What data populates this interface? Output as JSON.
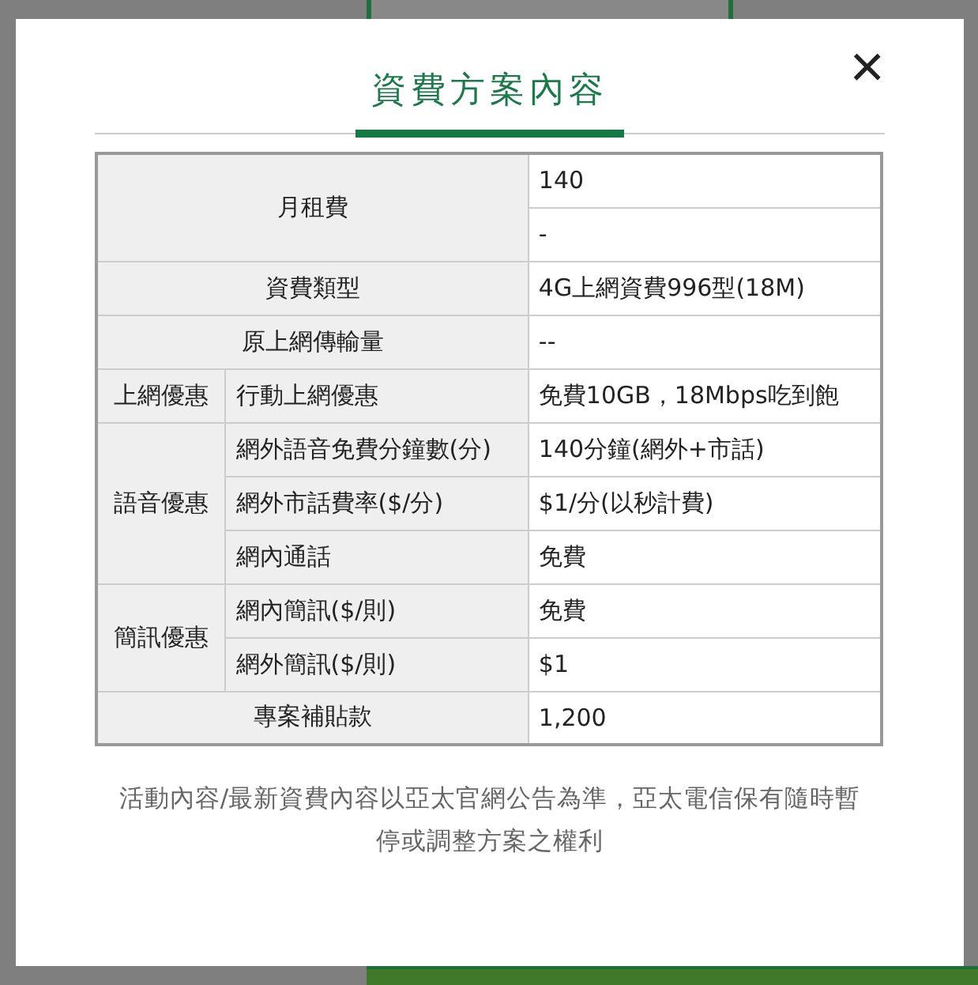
{
  "dialog": {
    "title": "資費方案內容",
    "close_icon": "×"
  },
  "table": {
    "groups": [
      {
        "kind": "merged",
        "label": "月租費",
        "values": [
          "140",
          "-"
        ]
      },
      {
        "kind": "merged",
        "label": "資費類型",
        "values": [
          "4G上網資費996型(18M)"
        ]
      },
      {
        "kind": "merged",
        "label": "原上網傳輸量",
        "values": [
          "--"
        ]
      },
      {
        "kind": "grouped",
        "label": "上網優惠",
        "items": [
          {
            "label": "行動上網優惠",
            "value": "免費10GB，18Mbps吃到飽"
          }
        ]
      },
      {
        "kind": "grouped",
        "label": "語音優惠",
        "items": [
          {
            "label": "網外語音免費分鐘數(分)",
            "value": "140分鐘(網外+市話)"
          },
          {
            "label": "網外市話費率($/分)",
            "value": "$1/分(以秒計費)"
          },
          {
            "label": "網內通話",
            "value": "免費"
          }
        ]
      },
      {
        "kind": "grouped",
        "label": "簡訊優惠",
        "items": [
          {
            "label": "網內簡訊($/則)",
            "value": "免費"
          },
          {
            "label": "網外簡訊($/則)",
            "value": "$1"
          }
        ]
      },
      {
        "kind": "merged",
        "label": "專案補貼款",
        "values": [
          "1,200"
        ]
      }
    ]
  },
  "note": "活動內容/最新資費內容以亞太官網公告為準，亞太電信保有隨時暫停或調整方案之權利"
}
